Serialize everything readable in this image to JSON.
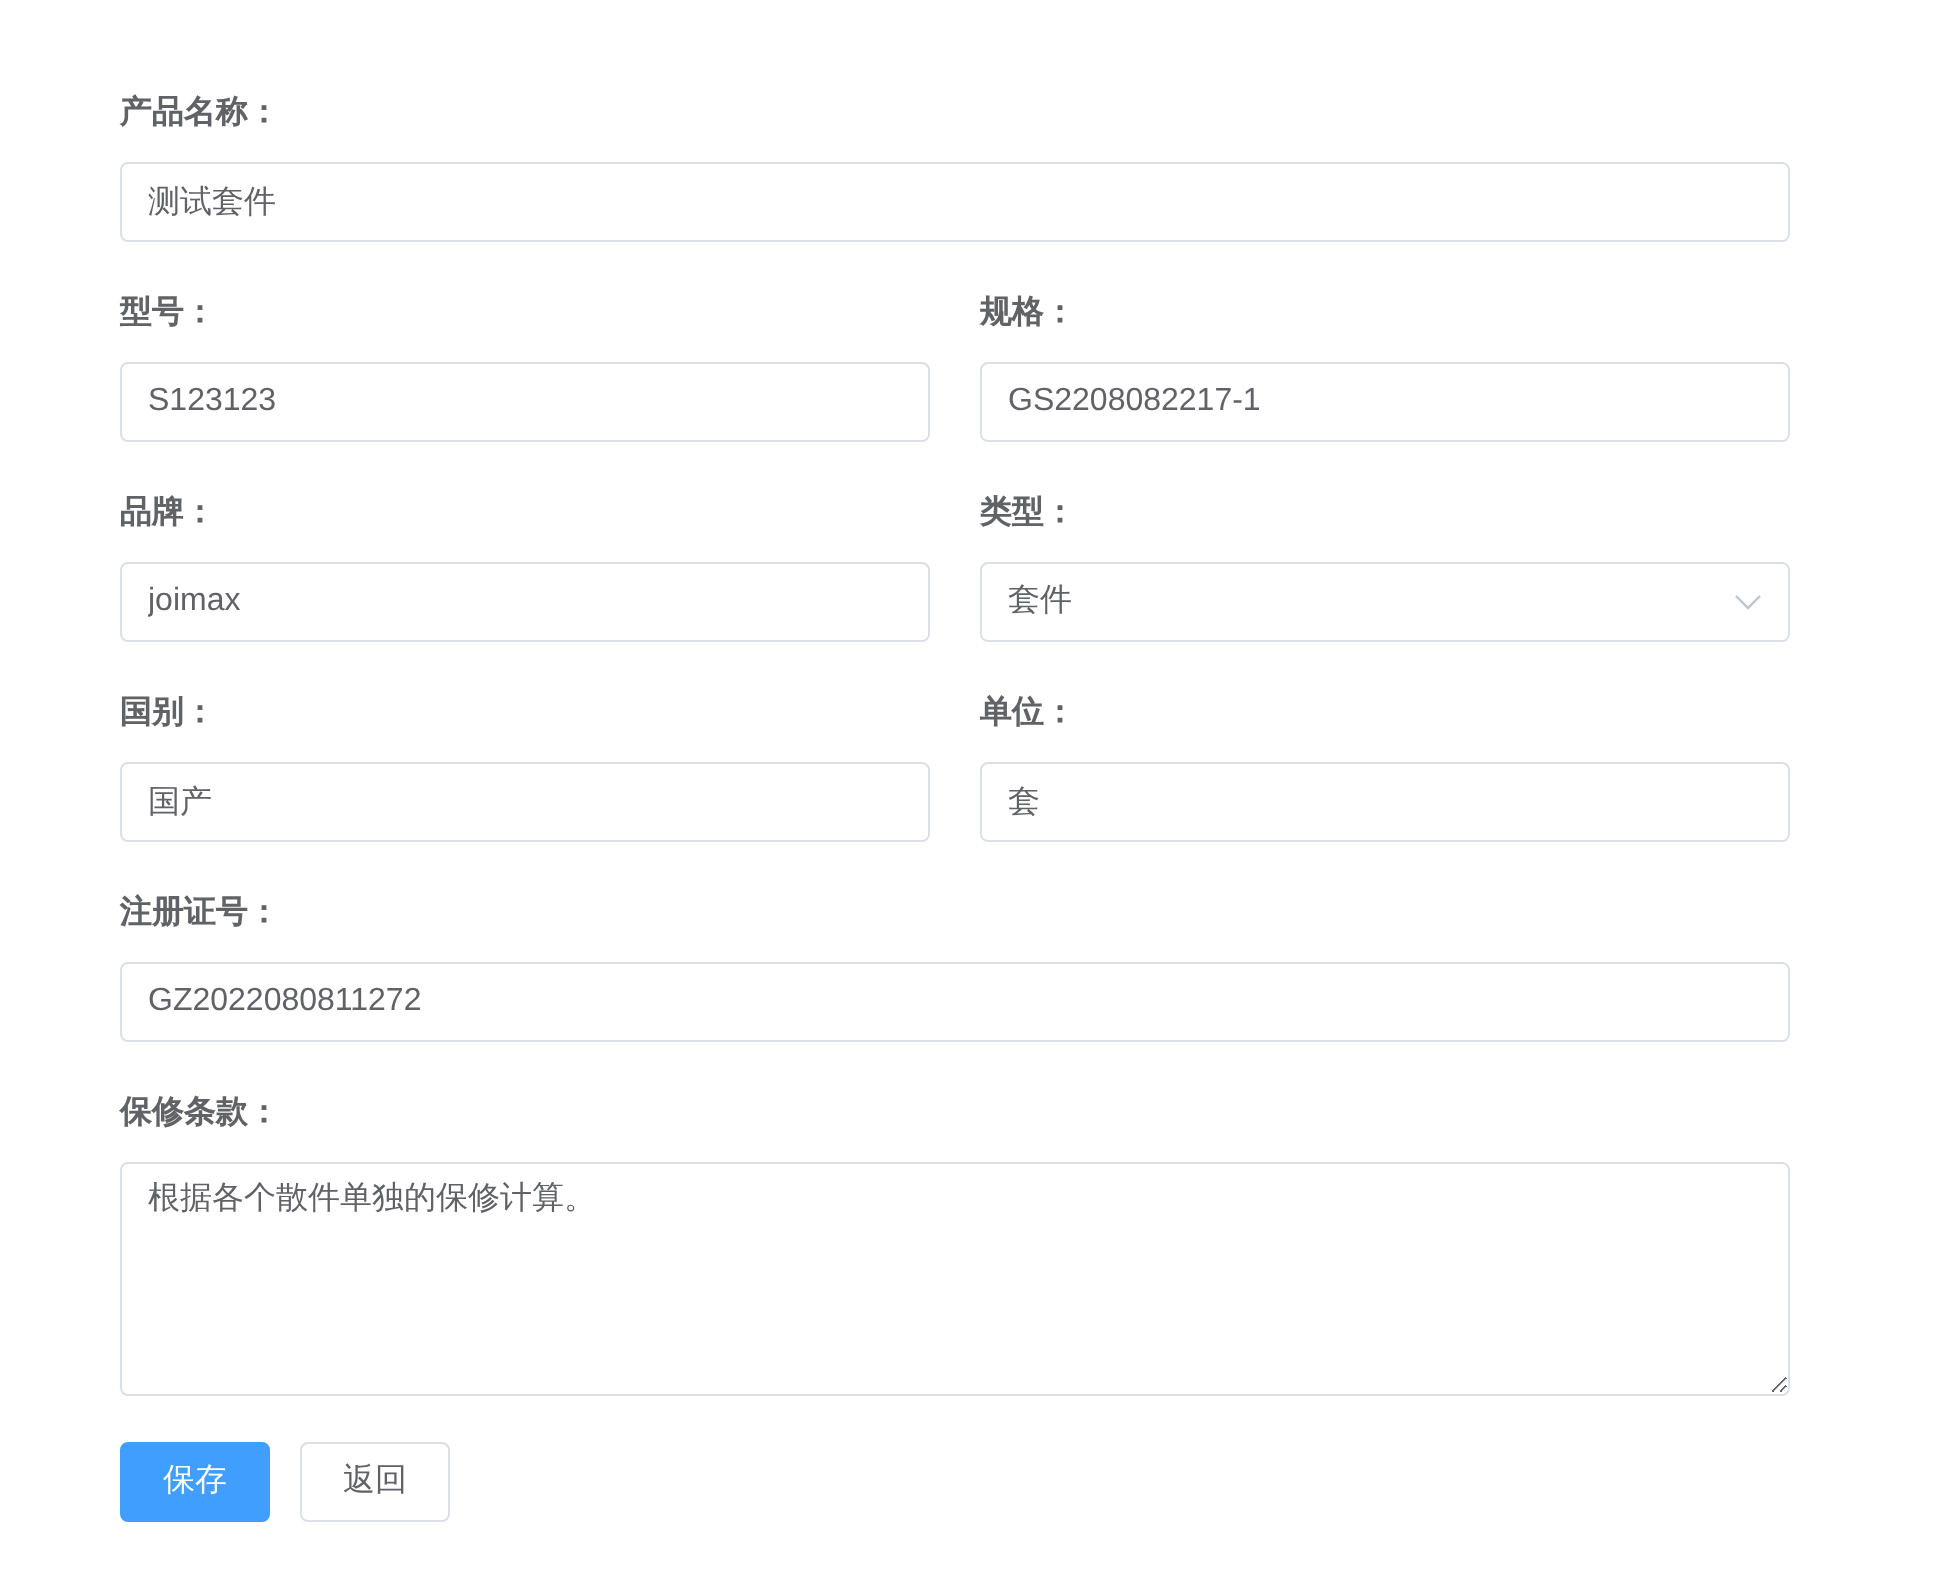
{
  "rows": [
    {
      "fields": [
        {
          "label": "产品名称：",
          "kind": "input",
          "value": "测试套件"
        }
      ]
    },
    {
      "fields": [
        {
          "label": "型号：",
          "kind": "input",
          "value": "S123123"
        },
        {
          "label": "规格：",
          "kind": "input",
          "value": "GS2208082217-1"
        }
      ]
    },
    {
      "fields": [
        {
          "label": "品牌：",
          "kind": "input",
          "value": "joimax"
        },
        {
          "label": "类型：",
          "kind": "select",
          "value": "套件"
        }
      ]
    },
    {
      "fields": [
        {
          "label": "国别：",
          "kind": "input",
          "value": "国产"
        },
        {
          "label": "单位：",
          "kind": "input",
          "value": "套"
        }
      ]
    },
    {
      "fields": [
        {
          "label": "注册证号：",
          "kind": "input",
          "value": "GZ2022080811272"
        }
      ]
    },
    {
      "fields": [
        {
          "label": "保修条款：",
          "kind": "textarea",
          "value": "根据各个散件单独的保修计算。"
        }
      ]
    }
  ],
  "buttons": [
    {
      "label": "保存",
      "kind": "primary"
    },
    {
      "label": "返回",
      "kind": "default"
    }
  ]
}
